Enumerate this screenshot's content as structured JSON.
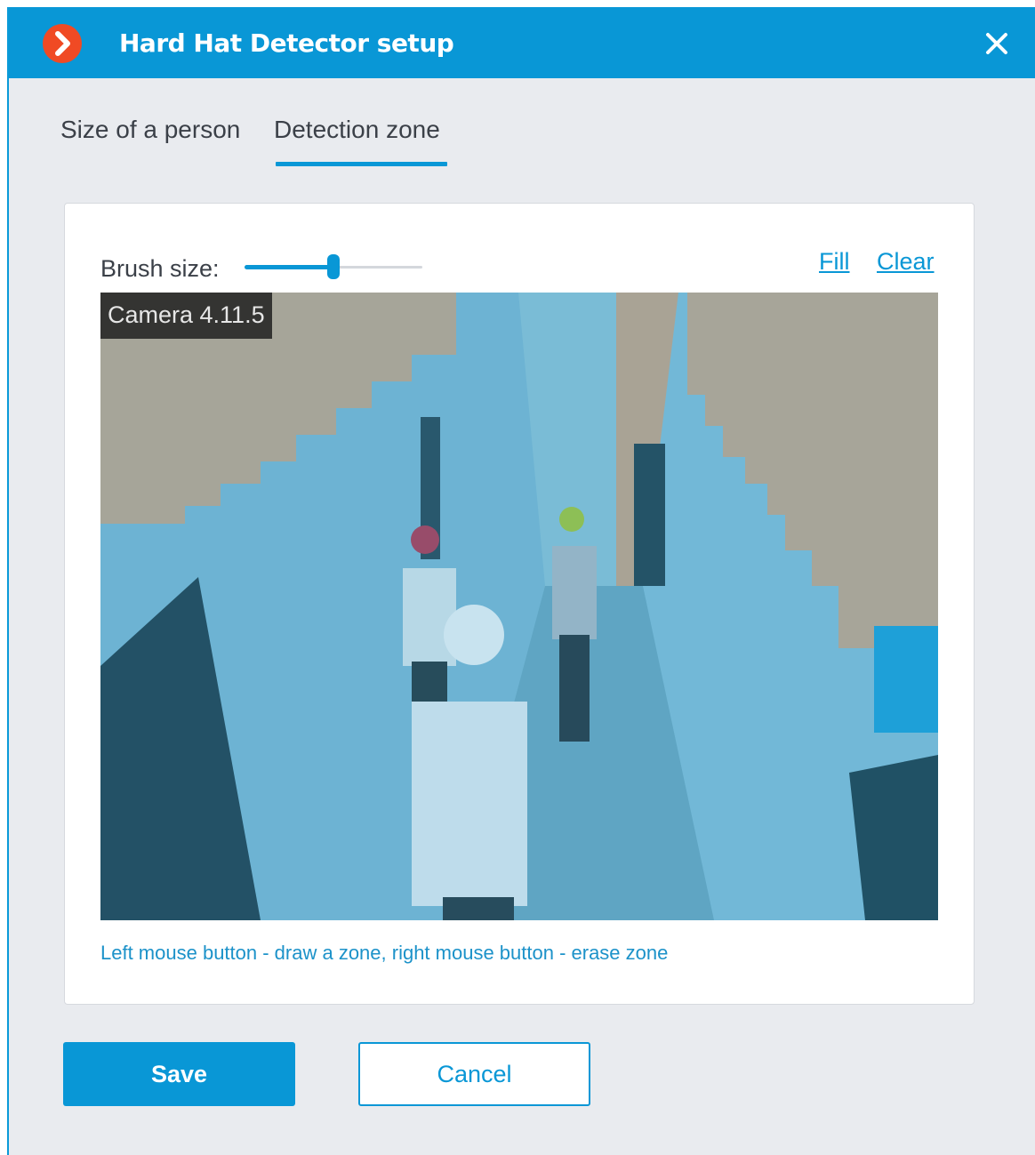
{
  "window": {
    "title": "Hard Hat Detector setup",
    "logo_icon": "chevron-right-icon",
    "close_icon": "close-icon"
  },
  "tabs": [
    {
      "label": "Size of a person",
      "active": false
    },
    {
      "label": "Detection zone",
      "active": true
    }
  ],
  "detection_zone": {
    "brush_label": "Brush size:",
    "brush_level_fraction": 0.5,
    "fill_label": "Fill",
    "clear_label": "Clear",
    "camera_name": "Camera 4.11.5",
    "hint": "Left mouse button - draw a zone, right mouse button - erase zone"
  },
  "buttons": {
    "save": "Save",
    "cancel": "Cancel"
  },
  "colors": {
    "accent": "#0997d6",
    "logo": "#f04a24",
    "zone_overlay": "#1e9fd9"
  }
}
